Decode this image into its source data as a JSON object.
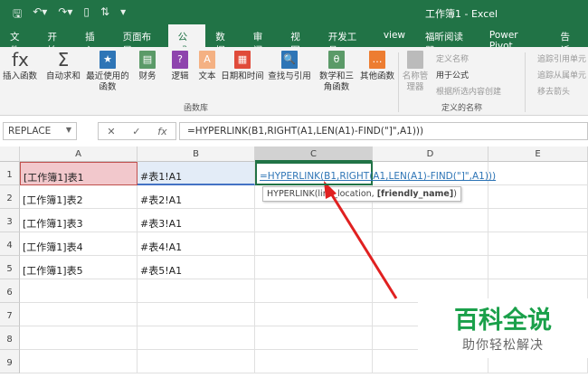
{
  "title": "工作簿1 - Excel",
  "quick_access": [
    "save-icon",
    "undo-icon",
    "redo-icon",
    "preview-icon",
    "sort-icon",
    "customize-icon"
  ],
  "tabs": [
    "文件",
    "开始",
    "插入",
    "页面布局",
    "公式",
    "数据",
    "审阅",
    "视图",
    "开发工具",
    "view",
    "福昕阅读器",
    "Power Pivot",
    "告诉"
  ],
  "active_tab": "公式",
  "ribbon": {
    "buttons": [
      {
        "label": "插入函数",
        "icon": "fx",
        "color": "#444444"
      },
      {
        "label": "自动求和",
        "icon": "Σ",
        "color": "#444444"
      },
      {
        "label": "最近使用的函数",
        "icon": "★",
        "color": "#2e75b6"
      },
      {
        "label": "财务",
        "icon": "▤",
        "color": "#5b9a68"
      },
      {
        "label": "逻辑",
        "icon": "?",
        "color": "#8e44ad"
      },
      {
        "label": "文本",
        "icon": "A",
        "color": "#f4b183"
      },
      {
        "label": "日期和时间",
        "icon": "▦",
        "color": "#e04b3a"
      },
      {
        "label": "查找与引用",
        "icon": "🔍",
        "color": "#2e75b6"
      },
      {
        "label": "数学和三角函数",
        "icon": "θ",
        "color": "#5b9a68"
      },
      {
        "label": "其他函数",
        "icon": "…",
        "color": "#ed7d31"
      }
    ],
    "group_functions": "函数库",
    "name_manager": "名称管理器",
    "define_name": "定义名称",
    "use_in_formula": "用于公式",
    "create_from_selection": "根据所选内容创建",
    "group_names": "定义的名称",
    "trace_precedents": "追踪引用单元",
    "trace_dependents": "追踪从属单元",
    "remove_arrows": "移去箭头"
  },
  "name_box": "REPLACE",
  "formula": "=HYPERLINK(B1,RIGHT(A1,LEN(A1)-FIND(\"]\",A1)))",
  "columns": [
    "A",
    "B",
    "C",
    "D",
    "E"
  ],
  "rows": [
    "1",
    "2",
    "3",
    "4",
    "5",
    "6",
    "7",
    "8",
    "9"
  ],
  "cells": {
    "A": [
      "[工作簿1]表1",
      "[工作簿1]表2",
      "[工作簿1]表3",
      "[工作簿1]表4",
      "[工作簿1]表5"
    ],
    "B": [
      "#表1!A1",
      "#表2!A1",
      "#表3!A1",
      "#表4!A1",
      "#表5!A1"
    ],
    "C1": "=HYPERLINK(B1,RIGHT(A1,LEN(A1)-FIND(\"]\",A1)))"
  },
  "tooltip": {
    "fn": "HYPERLINK(link_location, ",
    "arg": "[friendly_name]",
    ")": ")"
  },
  "watermark": {
    "title": "百科全说",
    "subtitle": "助你轻松解决"
  }
}
